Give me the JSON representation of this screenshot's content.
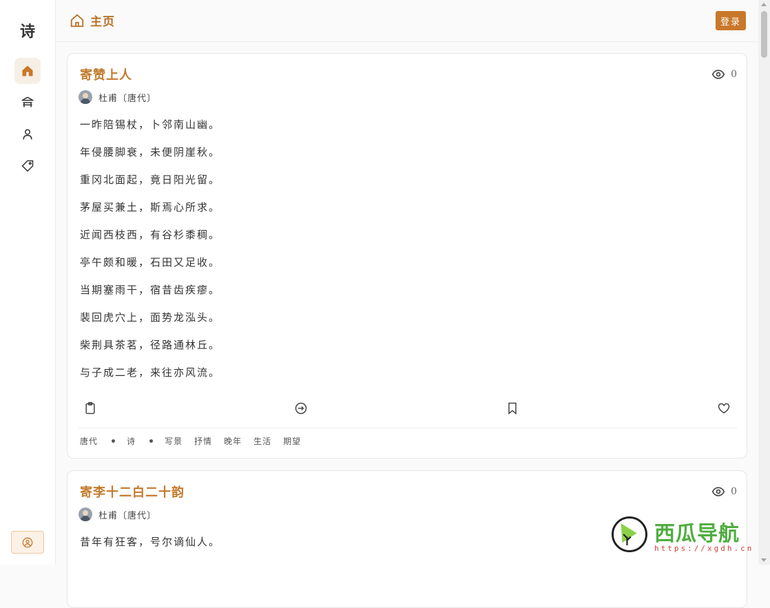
{
  "app": {
    "logo": "诗"
  },
  "header": {
    "title": "主页",
    "login_label": "登录"
  },
  "sidebar": {
    "items": [
      {
        "name": "home",
        "icon": "home-icon",
        "active": true
      },
      {
        "name": "library",
        "icon": "pavilion-icon",
        "active": false
      },
      {
        "name": "authors",
        "icon": "person-icon",
        "active": false
      },
      {
        "name": "tags",
        "icon": "tag-icon",
        "active": false
      }
    ],
    "user_icon": "user-circle-icon"
  },
  "poems": [
    {
      "title": "寄赞上人",
      "views": "0",
      "author": "杜甫〔唐代〕",
      "lines": [
        "一昨陪锡杖，卜邻南山幽。",
        "年侵腰脚衰，未便阴崖秋。",
        "重冈北面起，竟日阳光留。",
        "茅屋买兼土，斯焉心所求。",
        "近闻西枝西，有谷杉黍稠。",
        "亭午颇和暖，石田又足收。",
        "当期塞雨干，宿昔齿疾瘳。",
        "裴回虎穴上，面势龙泓头。",
        "柴荆具茶茗，径路通林丘。",
        "与子成二老，来往亦风流。"
      ],
      "actions": [
        "clipboard-icon",
        "arrow-right-circle-icon",
        "bookmark-icon",
        "heart-icon"
      ],
      "tags": [
        "唐代",
        "诗",
        "写景",
        "抒情",
        "晚年",
        "生活",
        "期望"
      ]
    },
    {
      "title": "寄李十二白二十韵",
      "views": "0",
      "author": "杜甫〔唐代〕",
      "lines": [
        "昔年有狂客，号尔谪仙人。"
      ]
    }
  ],
  "watermark": {
    "text": "西瓜导航",
    "url": "https://xgdh.cn"
  },
  "colors": {
    "accent": "#c27a2c",
    "button": "#c9782a",
    "watermark_green": "#4fae3f"
  }
}
